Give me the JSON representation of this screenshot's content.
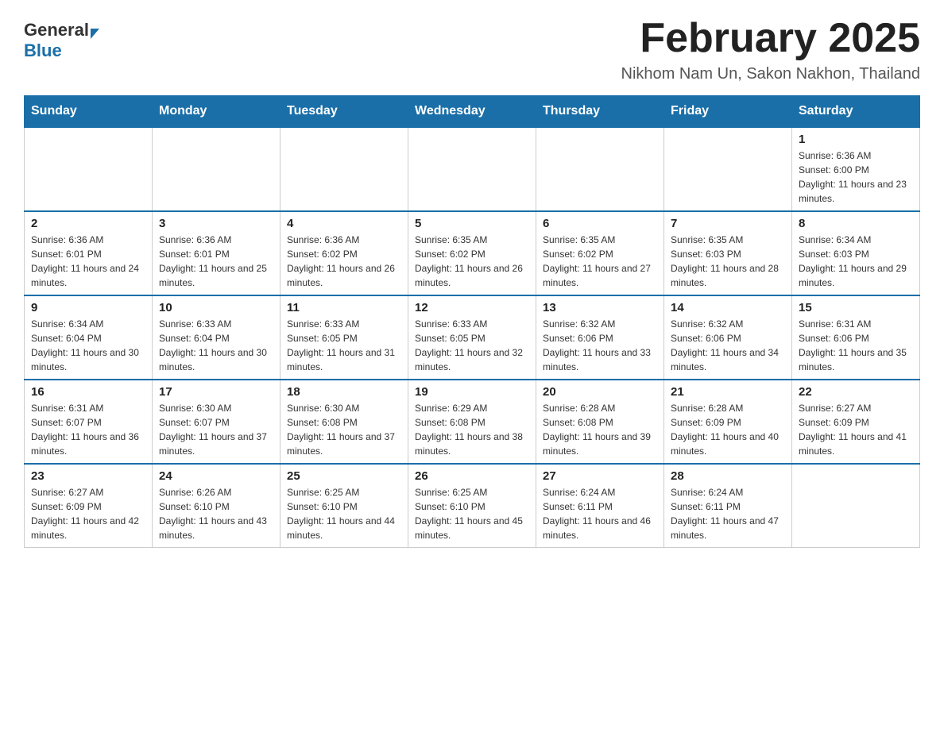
{
  "logo": {
    "general": "General",
    "blue": "Blue"
  },
  "header": {
    "month_year": "February 2025",
    "location": "Nikhom Nam Un, Sakon Nakhon, Thailand"
  },
  "days_of_week": [
    "Sunday",
    "Monday",
    "Tuesday",
    "Wednesday",
    "Thursday",
    "Friday",
    "Saturday"
  ],
  "weeks": [
    {
      "days": [
        {
          "number": "",
          "info": ""
        },
        {
          "number": "",
          "info": ""
        },
        {
          "number": "",
          "info": ""
        },
        {
          "number": "",
          "info": ""
        },
        {
          "number": "",
          "info": ""
        },
        {
          "number": "",
          "info": ""
        },
        {
          "number": "1",
          "info": "Sunrise: 6:36 AM\nSunset: 6:00 PM\nDaylight: 11 hours and 23 minutes."
        }
      ]
    },
    {
      "days": [
        {
          "number": "2",
          "info": "Sunrise: 6:36 AM\nSunset: 6:01 PM\nDaylight: 11 hours and 24 minutes."
        },
        {
          "number": "3",
          "info": "Sunrise: 6:36 AM\nSunset: 6:01 PM\nDaylight: 11 hours and 25 minutes."
        },
        {
          "number": "4",
          "info": "Sunrise: 6:36 AM\nSunset: 6:02 PM\nDaylight: 11 hours and 26 minutes."
        },
        {
          "number": "5",
          "info": "Sunrise: 6:35 AM\nSunset: 6:02 PM\nDaylight: 11 hours and 26 minutes."
        },
        {
          "number": "6",
          "info": "Sunrise: 6:35 AM\nSunset: 6:02 PM\nDaylight: 11 hours and 27 minutes."
        },
        {
          "number": "7",
          "info": "Sunrise: 6:35 AM\nSunset: 6:03 PM\nDaylight: 11 hours and 28 minutes."
        },
        {
          "number": "8",
          "info": "Sunrise: 6:34 AM\nSunset: 6:03 PM\nDaylight: 11 hours and 29 minutes."
        }
      ]
    },
    {
      "days": [
        {
          "number": "9",
          "info": "Sunrise: 6:34 AM\nSunset: 6:04 PM\nDaylight: 11 hours and 30 minutes."
        },
        {
          "number": "10",
          "info": "Sunrise: 6:33 AM\nSunset: 6:04 PM\nDaylight: 11 hours and 30 minutes."
        },
        {
          "number": "11",
          "info": "Sunrise: 6:33 AM\nSunset: 6:05 PM\nDaylight: 11 hours and 31 minutes."
        },
        {
          "number": "12",
          "info": "Sunrise: 6:33 AM\nSunset: 6:05 PM\nDaylight: 11 hours and 32 minutes."
        },
        {
          "number": "13",
          "info": "Sunrise: 6:32 AM\nSunset: 6:06 PM\nDaylight: 11 hours and 33 minutes."
        },
        {
          "number": "14",
          "info": "Sunrise: 6:32 AM\nSunset: 6:06 PM\nDaylight: 11 hours and 34 minutes."
        },
        {
          "number": "15",
          "info": "Sunrise: 6:31 AM\nSunset: 6:06 PM\nDaylight: 11 hours and 35 minutes."
        }
      ]
    },
    {
      "days": [
        {
          "number": "16",
          "info": "Sunrise: 6:31 AM\nSunset: 6:07 PM\nDaylight: 11 hours and 36 minutes."
        },
        {
          "number": "17",
          "info": "Sunrise: 6:30 AM\nSunset: 6:07 PM\nDaylight: 11 hours and 37 minutes."
        },
        {
          "number": "18",
          "info": "Sunrise: 6:30 AM\nSunset: 6:08 PM\nDaylight: 11 hours and 37 minutes."
        },
        {
          "number": "19",
          "info": "Sunrise: 6:29 AM\nSunset: 6:08 PM\nDaylight: 11 hours and 38 minutes."
        },
        {
          "number": "20",
          "info": "Sunrise: 6:28 AM\nSunset: 6:08 PM\nDaylight: 11 hours and 39 minutes."
        },
        {
          "number": "21",
          "info": "Sunrise: 6:28 AM\nSunset: 6:09 PM\nDaylight: 11 hours and 40 minutes."
        },
        {
          "number": "22",
          "info": "Sunrise: 6:27 AM\nSunset: 6:09 PM\nDaylight: 11 hours and 41 minutes."
        }
      ]
    },
    {
      "days": [
        {
          "number": "23",
          "info": "Sunrise: 6:27 AM\nSunset: 6:09 PM\nDaylight: 11 hours and 42 minutes."
        },
        {
          "number": "24",
          "info": "Sunrise: 6:26 AM\nSunset: 6:10 PM\nDaylight: 11 hours and 43 minutes."
        },
        {
          "number": "25",
          "info": "Sunrise: 6:25 AM\nSunset: 6:10 PM\nDaylight: 11 hours and 44 minutes."
        },
        {
          "number": "26",
          "info": "Sunrise: 6:25 AM\nSunset: 6:10 PM\nDaylight: 11 hours and 45 minutes."
        },
        {
          "number": "27",
          "info": "Sunrise: 6:24 AM\nSunset: 6:11 PM\nDaylight: 11 hours and 46 minutes."
        },
        {
          "number": "28",
          "info": "Sunrise: 6:24 AM\nSunset: 6:11 PM\nDaylight: 11 hours and 47 minutes."
        },
        {
          "number": "",
          "info": ""
        }
      ]
    }
  ]
}
